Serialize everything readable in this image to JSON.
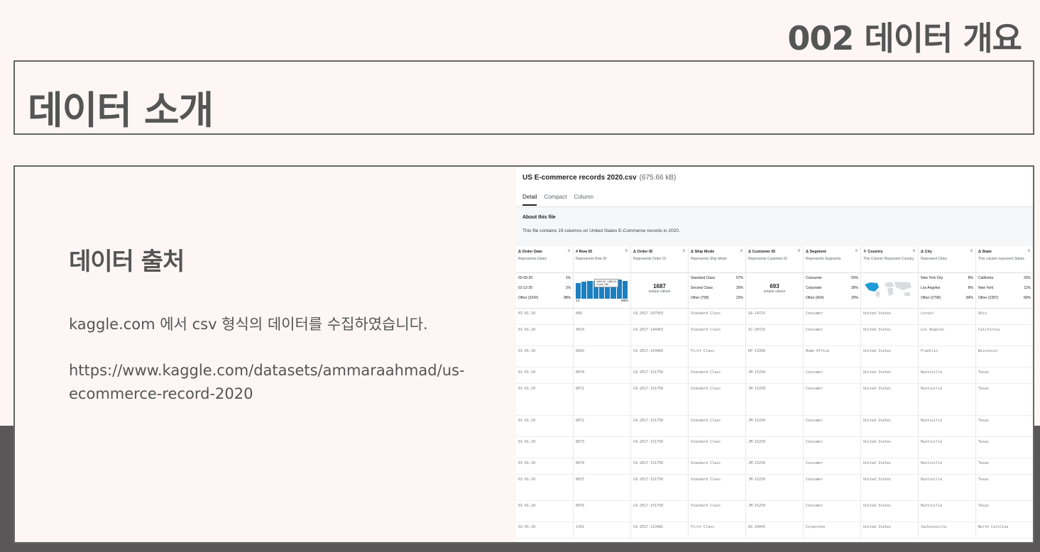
{
  "slide": {
    "number_title": "002 데이터 개요",
    "title": "데이터 소개",
    "source_heading": "데이터 출처",
    "source_text": "kaggle.com 에서 csv 형식의 데이터를 수집하였습니다.",
    "source_url": "https://www.kaggle.com/datasets/ammaraahmad/us-ecommerce-record-2020"
  },
  "kaggle": {
    "file_name": "US E-commerce records 2020.csv",
    "file_size": "(675.66 kB)",
    "tabs": [
      "Detail",
      "Compact",
      "Column"
    ],
    "active_tab": "Detail",
    "about_heading": "About this file",
    "about_text": "This file contains 19 columns on United States E-Commerce records in 2020.",
    "columns": [
      {
        "name": "Δ Order Date",
        "desc": "Represents Dates"
      },
      {
        "name": "# Row ID",
        "desc": "Represents Row ID"
      },
      {
        "name": "Δ Order ID",
        "desc": "Represents Order ID"
      },
      {
        "name": "Δ Ship Mode",
        "desc": "Represents Ship Mode"
      },
      {
        "name": "Δ Customer ID",
        "desc": "Represents Customer ID"
      },
      {
        "name": "Δ Segment",
        "desc": "Represents Segments"
      },
      {
        "name": "⚐ Country",
        "desc": "This Column Represent Country"
      },
      {
        "name": "Δ City",
        "desc": "Represent Cities"
      },
      {
        "name": "Δ State",
        "desc": "This column represent States"
      }
    ],
    "summary": {
      "order_date": [
        [
          "02-09-20",
          "1%"
        ],
        [
          "01-12-20",
          "1%"
        ],
        [
          "Other (3242)",
          "98%"
        ]
      ],
      "row_id": {
        "tooltip": "1660.00 - 1880.00\nCount: 336",
        "min": "13",
        "max": "9994",
        "bars": [
          0.75,
          0.8,
          0.85,
          0.82,
          0.88,
          0.8,
          0.86,
          0.9,
          0.84
        ]
      },
      "order_id": {
        "count": "1687",
        "label": "unique values"
      },
      "ship_mode": [
        [
          "Standard Class",
          "57%"
        ],
        [
          "Second Class",
          "20%"
        ],
        [
          "Other (758)",
          "23%"
        ]
      ],
      "customer_id": {
        "count": "693",
        "label": "unique values"
      },
      "segment": [
        [
          "Consumer",
          "50%"
        ],
        [
          "Corporate",
          "30%"
        ],
        [
          "Other (664)",
          "20%"
        ]
      ],
      "city": [
        [
          "New York City",
          "8%"
        ],
        [
          "Los Angeles",
          "8%"
        ],
        [
          "Other (2796)",
          "84%"
        ]
      ],
      "state": [
        [
          "California",
          "20%"
        ],
        [
          "New York",
          "11%"
        ],
        [
          "Other (2287)",
          "69%"
        ]
      ]
    },
    "rows": [
      {
        "h": 23,
        "cells": [
          "01-01-20",
          "849",
          "CA-2017-107503",
          "Standard Class",
          "GA-14725",
          "Consumer",
          "United States",
          "Lorain",
          "Ohio"
        ]
      },
      {
        "h": 30,
        "cells": [
          "01-01-20",
          "4010",
          "CA-2017-144463",
          "Standard Class",
          "SC-20725",
          "Consumer",
          "United States",
          "Los Angeles",
          "California"
        ]
      },
      {
        "h": 30,
        "cells": [
          "01-01-20",
          "6683",
          "CA-2017-154466",
          "First Class",
          "DP-13390",
          "Home Office",
          "United States",
          "Franklin",
          "Wisconsin"
        ]
      },
      {
        "h": 23,
        "cells": [
          "01-01-20",
          "8070",
          "CA-2017-151750",
          "Standard Class",
          "JM-15250",
          "Consumer",
          "United States",
          "Huntsville",
          "Texas"
        ]
      },
      {
        "h": 45,
        "cells": [
          "01-01-20",
          "8071",
          "CA-2017-151750",
          "Standard Class",
          "JM-15250",
          "Consumer",
          "United States",
          "Huntsville",
          "Texas"
        ]
      },
      {
        "h": 30,
        "cells": [
          "01-01-20",
          "8072",
          "CA-2017-151750",
          "Standard Class",
          "JM-15250",
          "Consumer",
          "United States",
          "Huntsville",
          "Texas"
        ]
      },
      {
        "h": 30,
        "cells": [
          "01-01-20",
          "8073",
          "CA-2017-151750",
          "Standard Class",
          "JM-15250",
          "Consumer",
          "United States",
          "Huntsville",
          "Texas"
        ]
      },
      {
        "h": 23,
        "cells": [
          "01-01-20",
          "8074",
          "CA-2017-151750",
          "Standard Class",
          "JM-15250",
          "Consumer",
          "United States",
          "Huntsville",
          "Texas"
        ]
      },
      {
        "h": 37,
        "cells": [
          "01-01-20",
          "8075",
          "CA-2017-151750",
          "Standard Class",
          "JM-15250",
          "Consumer",
          "United States",
          "Huntsville",
          "Texas"
        ]
      },
      {
        "h": 30,
        "cells": [
          "01-01-20",
          "8076",
          "CA-2017-151750",
          "Standard Class",
          "JM-15250",
          "Consumer",
          "United States",
          "Huntsville",
          "Texas"
        ]
      },
      {
        "h": 23,
        "cells": [
          "02-01-20",
          "1341",
          "CA-2017-113481",
          "First Class",
          "AS-10045",
          "Corporate",
          "United States",
          "Jacksonville",
          "North Carolina"
        ]
      }
    ]
  }
}
